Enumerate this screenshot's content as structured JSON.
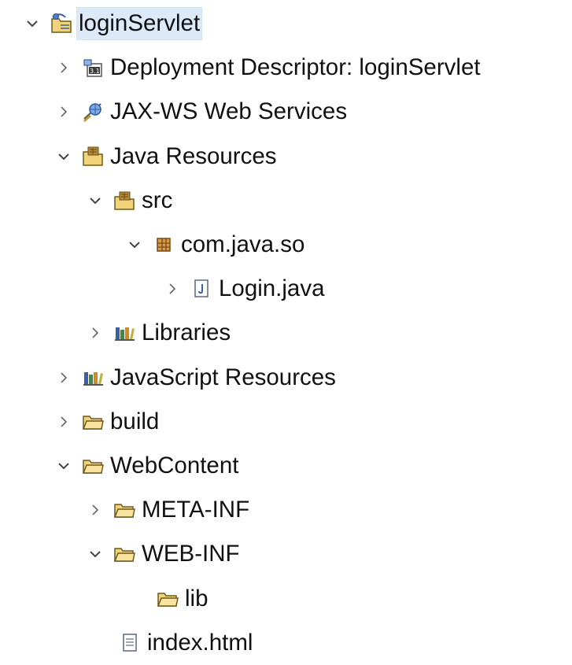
{
  "tree": {
    "items": [
      {
        "label": "loginServlet",
        "toggle": "expanded",
        "icon": "web-project-icon",
        "depth": 0
      },
      {
        "label": "Deployment Descriptor: loginServlet",
        "toggle": "collapsed",
        "icon": "deployment-descriptor-icon",
        "depth": 1
      },
      {
        "label": "JAX-WS Web Services",
        "toggle": "collapsed",
        "icon": "web-services-icon",
        "depth": 1
      },
      {
        "label": "Java Resources",
        "toggle": "expanded",
        "icon": "java-resources-icon",
        "depth": 1
      },
      {
        "label": "src",
        "toggle": "expanded",
        "icon": "source-folder-icon",
        "depth": 2
      },
      {
        "label": "com.java.so",
        "toggle": "expanded",
        "icon": "package-icon",
        "depth": 3
      },
      {
        "label": "Login.java",
        "toggle": "collapsed",
        "icon": "java-file-icon",
        "depth": 4
      },
      {
        "label": "Libraries",
        "toggle": "collapsed",
        "icon": "libraries-icon",
        "depth": 2
      },
      {
        "label": "JavaScript Resources",
        "toggle": "collapsed",
        "icon": "libraries-icon",
        "depth": 1
      },
      {
        "label": "build",
        "toggle": "collapsed",
        "icon": "folder-icon",
        "depth": 1
      },
      {
        "label": "WebContent",
        "toggle": "expanded",
        "icon": "folder-icon",
        "depth": 1
      },
      {
        "label": "META-INF",
        "toggle": "collapsed",
        "icon": "folder-icon",
        "depth": 2
      },
      {
        "label": "WEB-INF",
        "toggle": "expanded",
        "icon": "folder-icon",
        "depth": 2
      },
      {
        "label": "lib",
        "toggle": "none",
        "icon": "folder-icon",
        "depth": 3
      },
      {
        "label": "index.html",
        "toggle": "none",
        "icon": "html-file-icon",
        "depth": 2
      }
    ]
  }
}
